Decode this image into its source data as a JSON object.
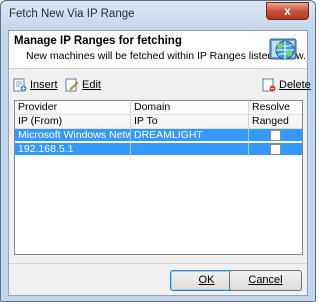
{
  "window": {
    "title": "Fetch New Via IP Range",
    "close_glyph": "x"
  },
  "header": {
    "title": "Manage IP Ranges for fetching",
    "subtitle": "New machines will be fetched within IP Ranges listed below.",
    "icon": "network-globe-icon"
  },
  "toolbar": {
    "insert_label": "Insert",
    "edit_label": "Edit",
    "delete_label": "Delete"
  },
  "grid": {
    "columns_row1": [
      "Provider",
      "Domain",
      "Resolve"
    ],
    "columns_row2": [
      "IP (From)",
      "IP To",
      "Ranged"
    ],
    "rows": [
      {
        "col1": "Microsoft Windows Network",
        "col2": "DREAMLIGHT",
        "ranged": false
      },
      {
        "col1": "192.168.5.1",
        "col2": "",
        "ranged": false
      }
    ],
    "selection_color": "#3399ff"
  },
  "footer": {
    "ok_label": "OK",
    "cancel_label": "Cancel"
  }
}
